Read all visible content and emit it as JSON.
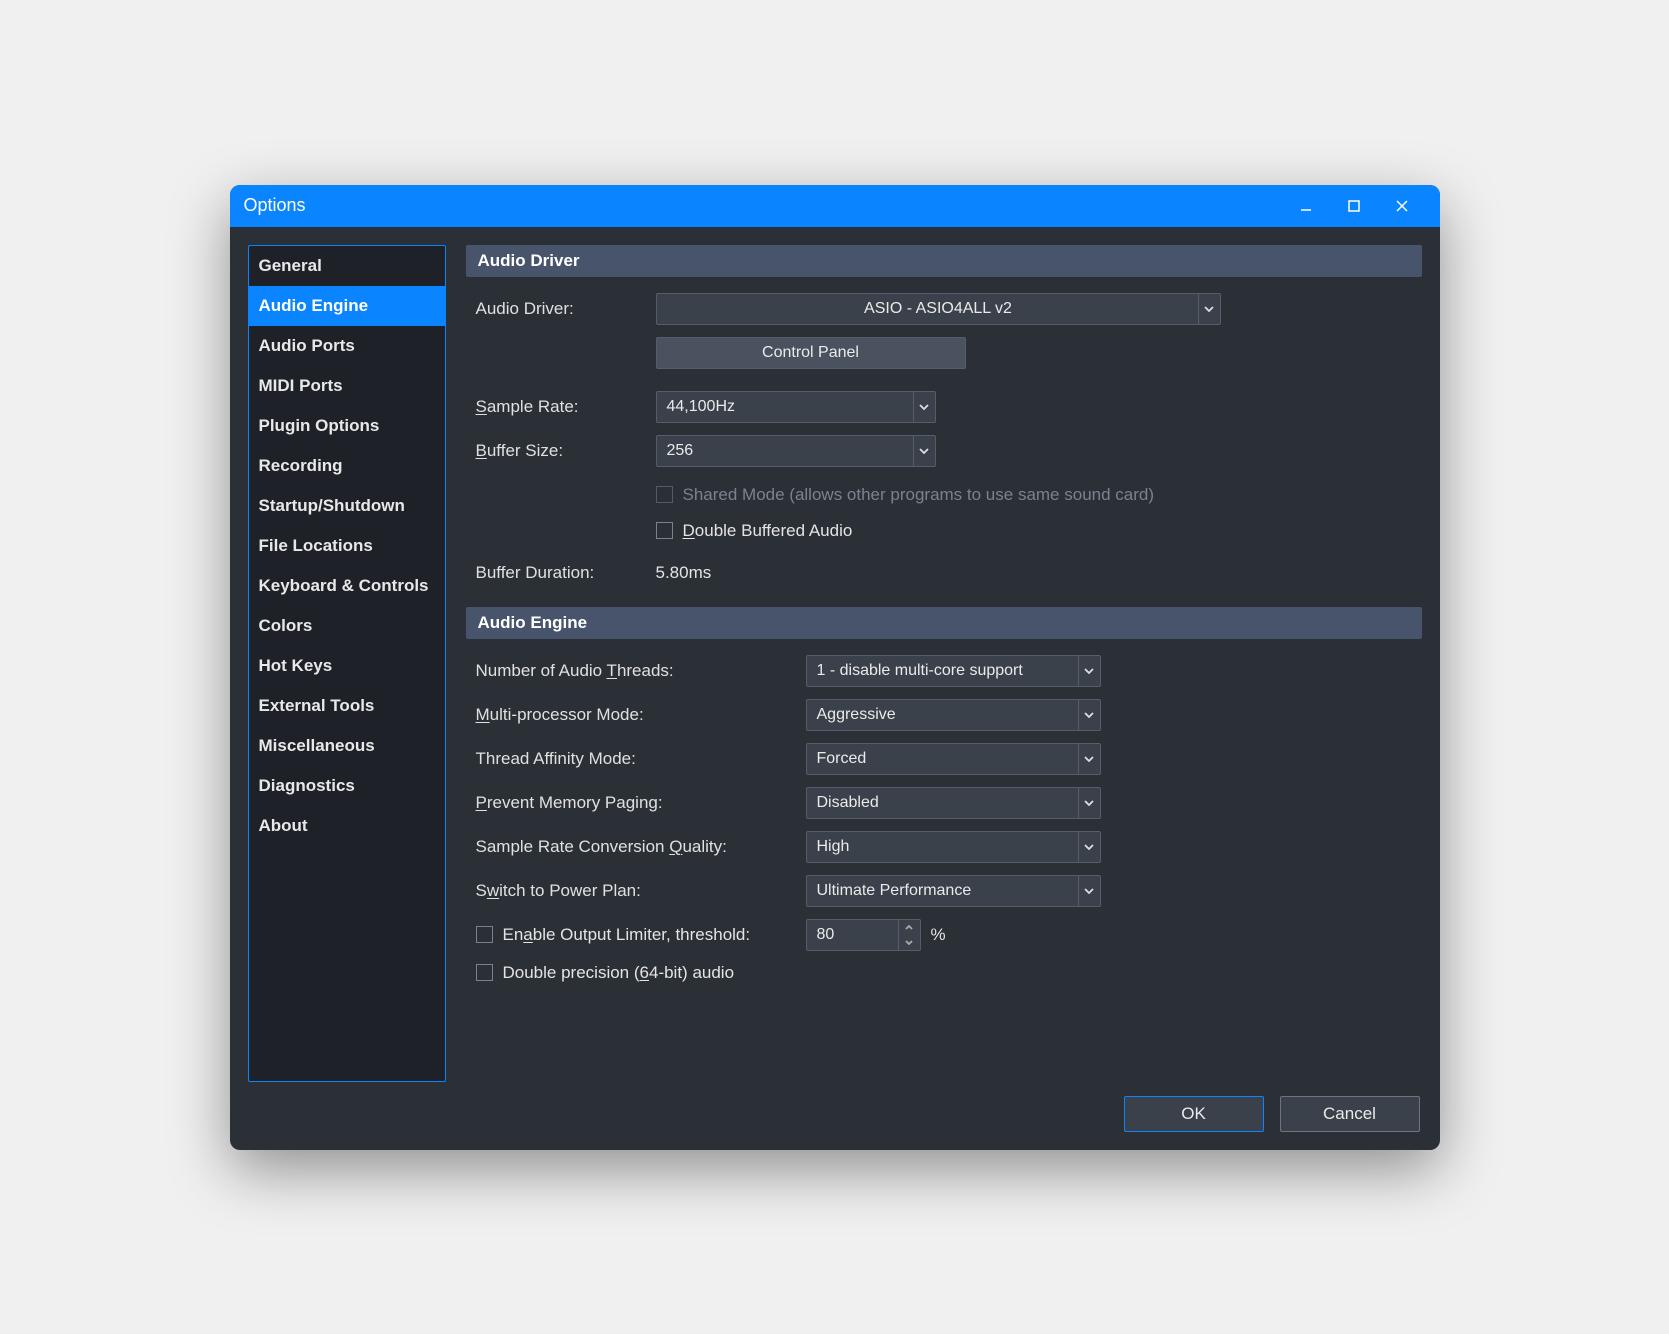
{
  "window": {
    "title": "Options"
  },
  "sidebar": {
    "items": [
      "General",
      "Audio Engine",
      "Audio Ports",
      "MIDI Ports",
      "Plugin Options",
      "Recording",
      "Startup/Shutdown",
      "File Locations",
      "Keyboard & Controls",
      "Colors",
      "Hot Keys",
      "External Tools",
      "Miscellaneous",
      "Diagnostics",
      "About"
    ],
    "active_index": 1
  },
  "sections": {
    "driver": {
      "title": "Audio Driver",
      "audio_driver_label": "Audio Driver:",
      "audio_driver_value": "ASIO - ASIO4ALL v2",
      "control_panel_label": "Control Panel",
      "sample_rate_label_pre": "S",
      "sample_rate_label_post": "ample Rate:",
      "sample_rate_value": "44,100Hz",
      "buffer_size_label_pre": "B",
      "buffer_size_label_post": "uffer Size:",
      "buffer_size_value": "256",
      "shared_mode_label": "Shared Mode (allows other programs to use same sound card)",
      "double_buffered_pre": "D",
      "double_buffered_post": "ouble Buffered Audio",
      "buffer_duration_label": "Buffer Duration:",
      "buffer_duration_value": "5.80ms"
    },
    "engine": {
      "title": "Audio Engine",
      "threads_label_pre": "Number of Audio ",
      "threads_label_u": "T",
      "threads_label_post": "hreads:",
      "threads_value": "1 - disable multi-core support",
      "mpm_label_u": "M",
      "mpm_label_post": "ulti-processor Mode:",
      "mpm_value": "Aggressive",
      "affinity_label": "Thread Affinity Mode:",
      "affinity_value": "Forced",
      "paging_label_u": "P",
      "paging_label_post": "revent Memory Paging:",
      "paging_value": "Disabled",
      "src_label_pre": "Sample Rate Conversion ",
      "src_label_u": "Q",
      "src_label_post": "uality:",
      "src_value": "High",
      "power_label_pre": "S",
      "power_label_u": "w",
      "power_label_post": "itch to Power Plan:",
      "power_value": "Ultimate Performance",
      "limiter_label_pre": "En",
      "limiter_label_u": "a",
      "limiter_label_post": "ble Output Limiter, threshold:",
      "limiter_value": "80",
      "limiter_unit": "%",
      "dp_label_pre": "Double precision (",
      "dp_label_u": "6",
      "dp_label_post": "4-bit) audio"
    }
  },
  "footer": {
    "ok": "OK",
    "cancel": "Cancel"
  }
}
